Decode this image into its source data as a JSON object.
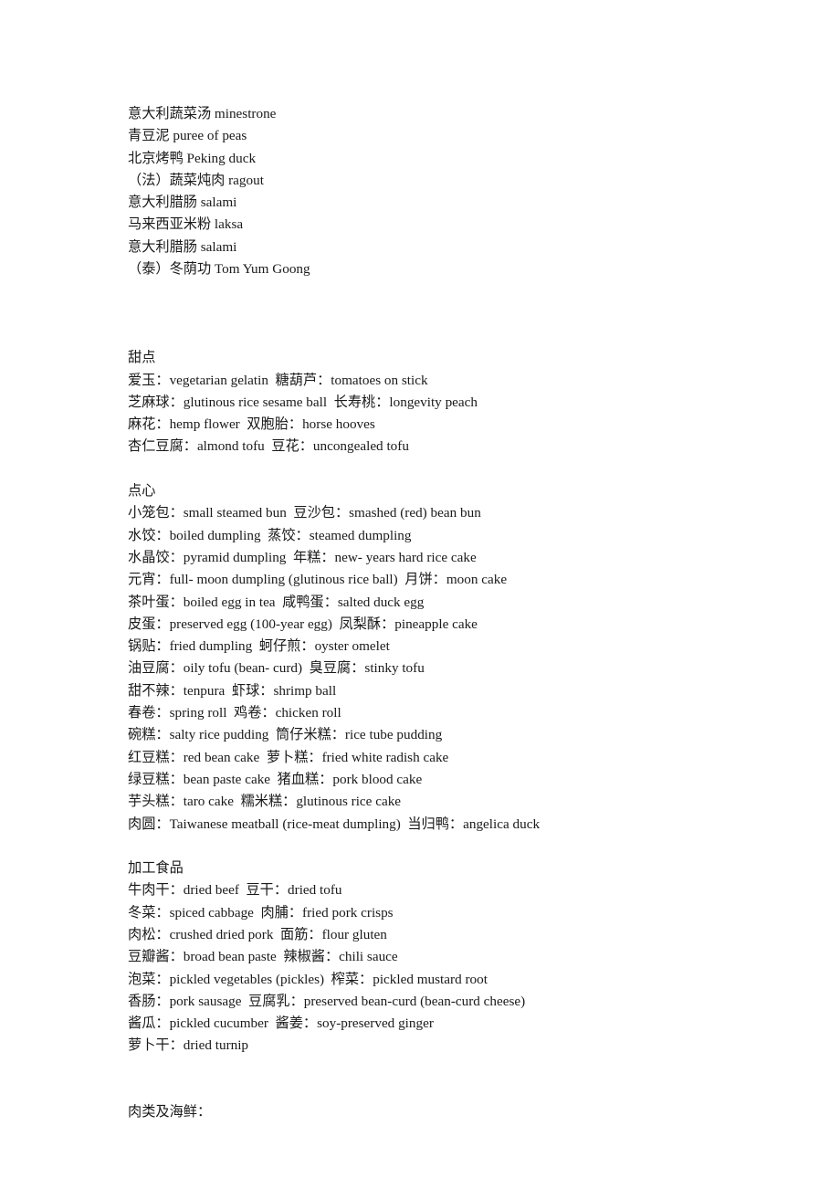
{
  "document": {
    "blocks": [
      {
        "id": "soups-and-dishes",
        "heading": null,
        "lines": [
          "意大利蔬菜汤 minestrone",
          "青豆泥 puree of peas",
          "北京烤鸭 Peking duck",
          "（法）蔬菜炖肉 ragout",
          "意大利腊肠 salami",
          "马来西亚米粉 laksa",
          "意大利腊肠 salami",
          "（泰）冬荫功 Tom Yum Goong"
        ]
      },
      {
        "id": "desserts",
        "heading": "甜点",
        "lines": [
          "爱玉：vegetarian gelatin  糖葫芦：tomatoes on stick",
          "芝麻球：glutinous rice sesame ball  长寿桃：longevity peach",
          "麻花：hemp flower  双胞胎：horse hooves",
          "杏仁豆腐：almond tofu  豆花：uncongealed tofu"
        ]
      },
      {
        "id": "dim-sum",
        "heading": "点心",
        "lines": [
          "小笼包：small steamed bun  豆沙包：smashed (red) bean bun",
          "水饺：boiled dumpling  蒸饺：steamed dumpling",
          "水晶饺：pyramid dumpling  年糕：new- years hard rice cake",
          "元宵：full- moon dumpling (glutinous rice ball)  月饼：moon cake",
          "茶叶蛋：boiled egg in tea  咸鸭蛋：salted duck egg",
          "皮蛋：preserved egg (100-year egg)  凤梨酥：pineapple cake",
          "锅贴：fried dumpling  蚵仔煎：oyster omelet",
          "油豆腐：oily tofu (bean- curd)  臭豆腐：stinky tofu",
          "甜不辣：tenpura  虾球：shrimp ball",
          "春卷：spring roll  鸡卷：chicken roll",
          "碗糕：salty rice pudding  筒仔米糕：rice tube pudding",
          "红豆糕：red bean cake  萝卜糕：fried white radish cake",
          "绿豆糕：bean paste cake  猪血糕：pork blood cake",
          "芋头糕：taro cake  糯米糕：glutinous rice cake",
          "肉圆：Taiwanese meatball (rice-meat dumpling)  当归鸭：angelica duck"
        ]
      },
      {
        "id": "processed-foods",
        "heading": "加工食品",
        "lines": [
          "牛肉干：dried beef  豆干：dried tofu",
          "冬菜：spiced cabbage  肉脯：fried pork crisps",
          "肉松：crushed dried pork  面筋：flour gluten",
          "豆瓣酱：broad bean paste  辣椒酱：chili sauce",
          "泡菜：pickled vegetables (pickles)  榨菜：pickled mustard root",
          "香肠：pork sausage  豆腐乳：preserved bean-curd (bean-curd cheese)",
          "酱瓜：pickled cucumber  酱姜：soy-preserved ginger",
          "萝卜干：dried turnip"
        ]
      },
      {
        "id": "meat-and-seafood",
        "heading": "肉类及海鲜：",
        "lines": []
      }
    ]
  }
}
